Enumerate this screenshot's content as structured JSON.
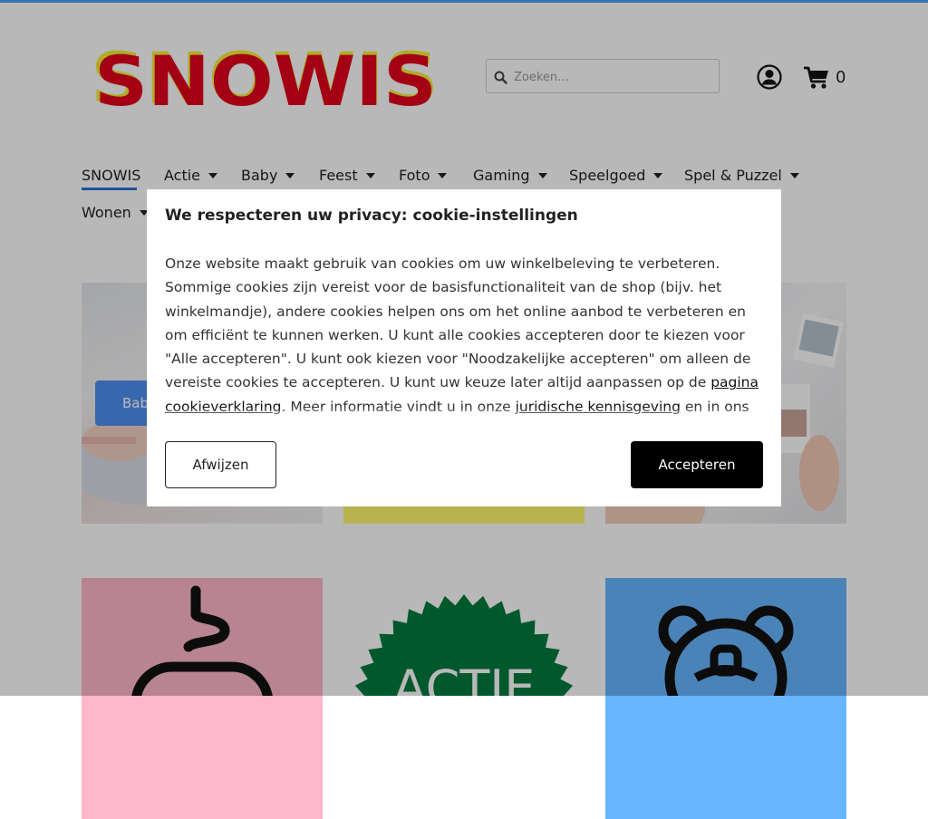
{
  "brand": {
    "logo_text": "SNOWIS",
    "logo_colors": {
      "text": "#e3001b",
      "shadow": "#f4ef3a"
    }
  },
  "header": {
    "search_placeholder": "Zoeken...",
    "account_icon": "user-circle-icon",
    "cart_icon": "shopping-cart-icon",
    "cart_count": "0"
  },
  "nav": {
    "items": [
      {
        "label": "SNOWIS",
        "has_dropdown": false,
        "active": true
      },
      {
        "label": "Actie",
        "has_dropdown": true
      },
      {
        "label": "Baby",
        "has_dropdown": true
      },
      {
        "label": "Feest",
        "has_dropdown": true
      },
      {
        "label": "Foto",
        "has_dropdown": true
      },
      {
        "label": "Gaming",
        "has_dropdown": true
      },
      {
        "label": "Speelgoed",
        "has_dropdown": true
      },
      {
        "label": "Spel & Puzzel",
        "has_dropdown": true
      },
      {
        "label": "Wonen",
        "has_dropdown": true
      }
    ],
    "active_color": "#2d6fd6"
  },
  "tiles": {
    "baby_button_label": "Baby",
    "tile2_text": "ACTIE",
    "colors": {
      "pink": "#ffb8cb",
      "yellow": "#fff870",
      "blue": "#67b6ff",
      "green": "#007a3d"
    }
  },
  "cookie": {
    "title": "We respecteren uw privacy: cookie-instellingen",
    "text_1": "Onze website maakt gebruik van cookies om uw winkelbeleving te verbeteren. Sommige cookies zijn vereist voor de basisfunctionaliteit van de shop (bijv. het winkelmandje), andere cookies helpen ons om het online aanbod te verbeteren en om efficiënt te kunnen werken. U kunt alle cookies accepteren door te kiezen voor \"Alle accepteren\". U kunt ook kiezen voor \"Noodzakelijke accepteren\" om alleen de vereiste cookies te accepteren. U kunt uw keuze later altijd aanpassen op de ",
    "link_1": "pagina cookieverklaring",
    "text_2": ". Meer informatie vindt u in onze ",
    "link_2": "juridische kennisgeving",
    "text_3": " en in ons",
    "reject_label": "Afwijzen",
    "accept_label": "Accepteren"
  }
}
